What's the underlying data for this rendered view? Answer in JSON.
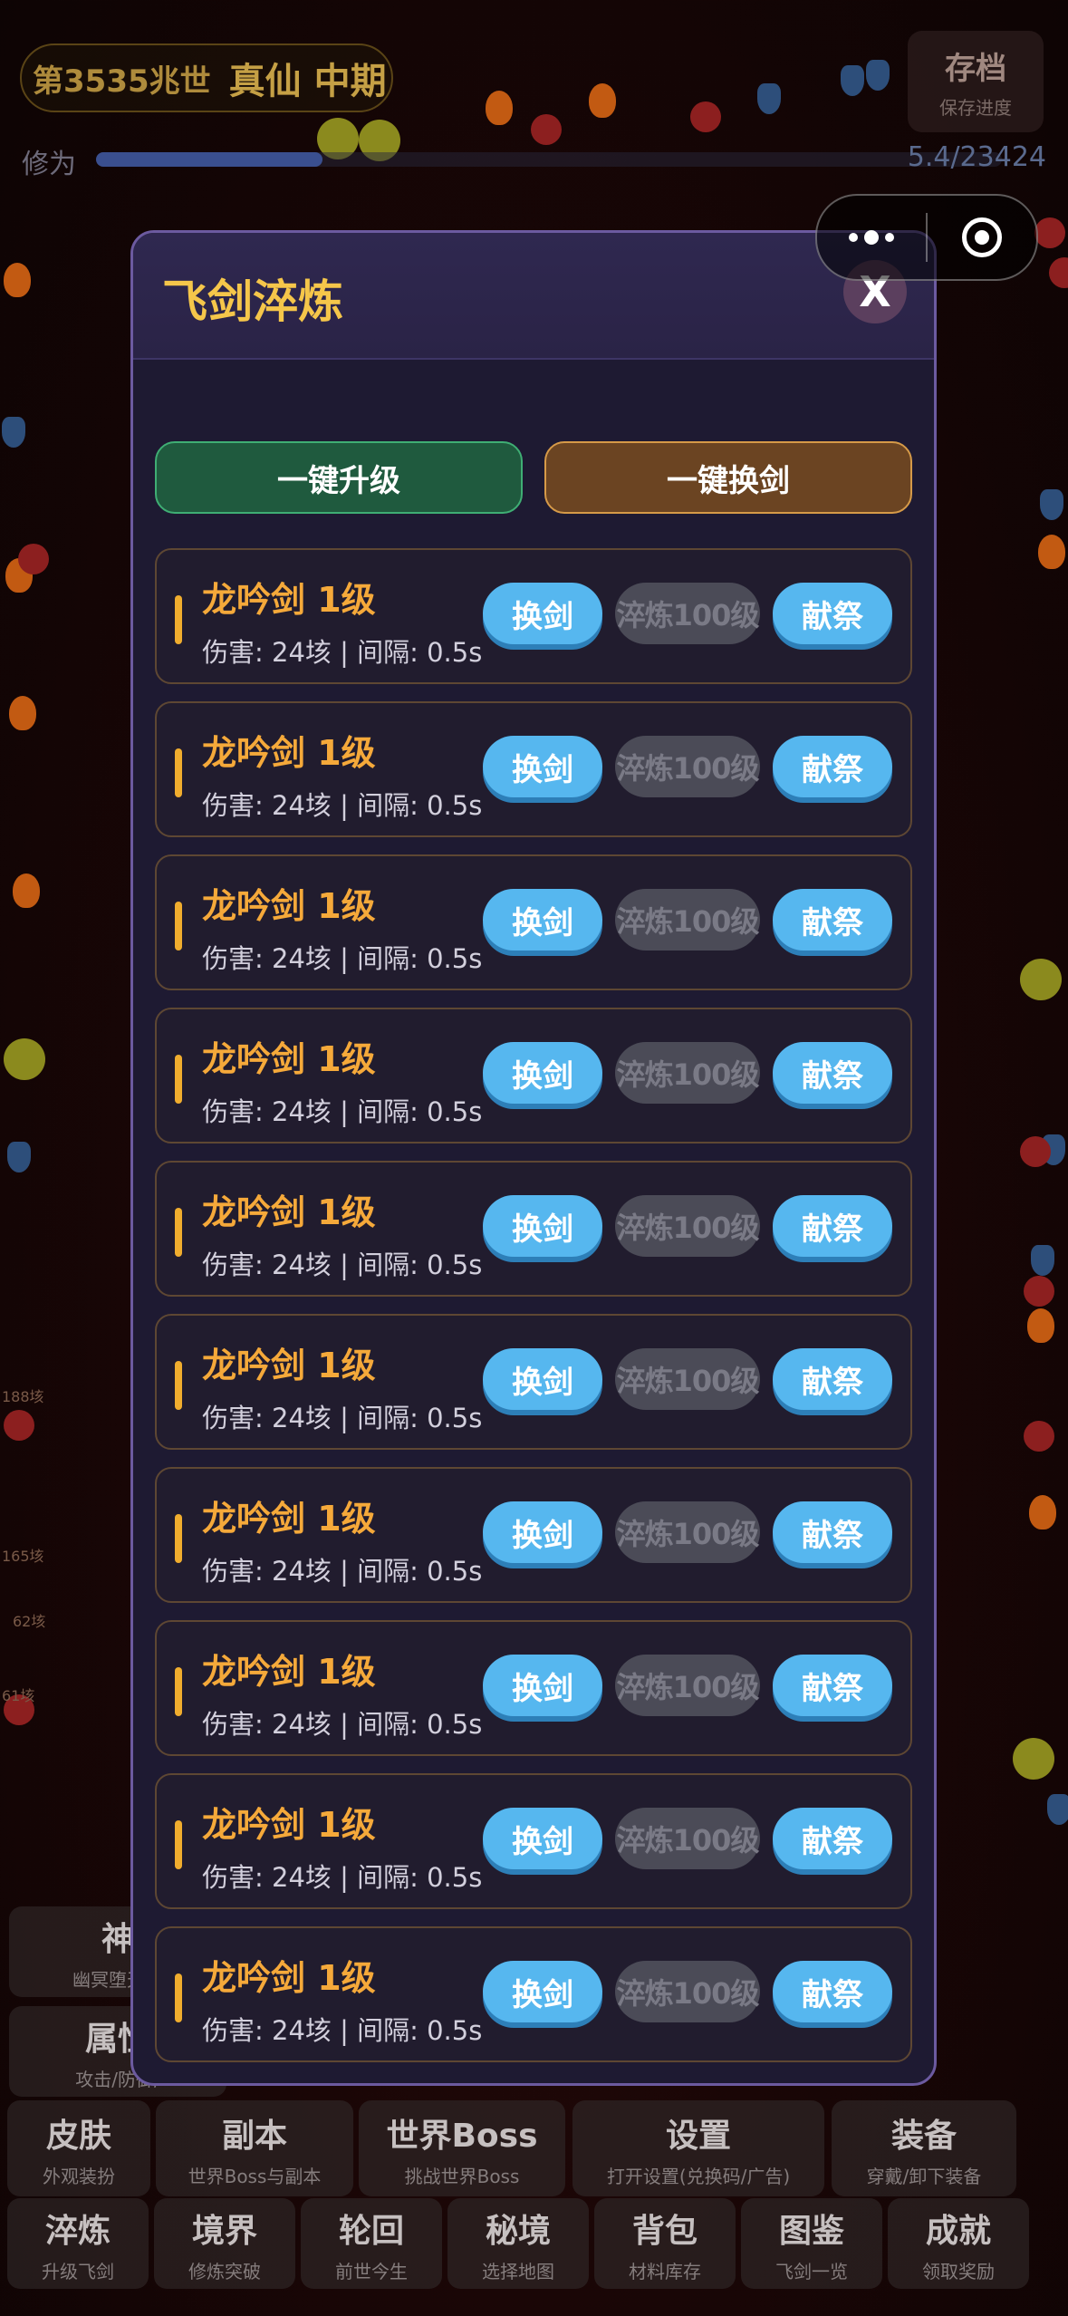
{
  "hud": {
    "era": "第3535兆世",
    "realm": "真仙 中期",
    "save_title": "存档",
    "save_sub": "保存进度",
    "xiuwei_label": "修为",
    "xiuwei_progress": 0.25,
    "xiuwei_value": "5.4/23424"
  },
  "capsule": {
    "more_icon": "more-dots-icon",
    "close_icon": "target-icon"
  },
  "background_labels": [
    "188垓",
    "165垓",
    "62垓",
    "61垓"
  ],
  "modal": {
    "title": "飞剑淬炼",
    "close_label": "X",
    "upgrade_all_label": "一键升级",
    "swap_all_label": "一键换剑",
    "swords": [
      {
        "name": "龙吟剑 1级",
        "stats": "伤害: 24垓 | 间隔: 0.5s",
        "swap": "换剑",
        "temper": "淬炼100级",
        "sacrifice": "献祭"
      },
      {
        "name": "龙吟剑 1级",
        "stats": "伤害: 24垓 | 间隔: 0.5s",
        "swap": "换剑",
        "temper": "淬炼100级",
        "sacrifice": "献祭"
      },
      {
        "name": "龙吟剑 1级",
        "stats": "伤害: 24垓 | 间隔: 0.5s",
        "swap": "换剑",
        "temper": "淬炼100级",
        "sacrifice": "献祭"
      },
      {
        "name": "龙吟剑 1级",
        "stats": "伤害: 24垓 | 间隔: 0.5s",
        "swap": "换剑",
        "temper": "淬炼100级",
        "sacrifice": "献祭"
      },
      {
        "name": "龙吟剑 1级",
        "stats": "伤害: 24垓 | 间隔: 0.5s",
        "swap": "换剑",
        "temper": "淬炼100级",
        "sacrifice": "献祭"
      },
      {
        "name": "龙吟剑 1级",
        "stats": "伤害: 24垓 | 间隔: 0.5s",
        "swap": "换剑",
        "temper": "淬炼100级",
        "sacrifice": "献祭"
      },
      {
        "name": "龙吟剑 1级",
        "stats": "伤害: 24垓 | 间隔: 0.5s",
        "swap": "换剑",
        "temper": "淬炼100级",
        "sacrifice": "献祭"
      },
      {
        "name": "龙吟剑 1级",
        "stats": "伤害: 24垓 | 间隔: 0.5s",
        "swap": "换剑",
        "temper": "淬炼100级",
        "sacrifice": "献祭"
      },
      {
        "name": "龙吟剑 1级",
        "stats": "伤害: 24垓 | 间隔: 0.5s",
        "swap": "换剑",
        "temper": "淬炼100级",
        "sacrifice": "献祭"
      },
      {
        "name": "龙吟剑 1级",
        "stats": "伤害: 24垓 | 间隔: 0.5s",
        "swap": "换剑",
        "temper": "淬炼100级",
        "sacrifice": "献祭"
      }
    ]
  },
  "menu": {
    "row0": [
      {
        "title": "神",
        "sub": "幽冥堕天帝"
      },
      {
        "title": "属性",
        "sub": "攻击/防御/"
      }
    ],
    "row1": [
      {
        "title": "皮肤",
        "sub": "外观装扮"
      },
      {
        "title": "副本",
        "sub": "世界Boss与副本"
      },
      {
        "title": "世界Boss",
        "sub": "挑战世界Boss"
      },
      {
        "title": "设置",
        "sub": "打开设置(兑换码/广告)"
      },
      {
        "title": "装备",
        "sub": "穿戴/卸下装备"
      }
    ],
    "row2": [
      {
        "title": "淬炼",
        "sub": "升级飞剑"
      },
      {
        "title": "境界",
        "sub": "修炼突破"
      },
      {
        "title": "轮回",
        "sub": "前世今生"
      },
      {
        "title": "秘境",
        "sub": "选择地图"
      },
      {
        "title": "背包",
        "sub": "材料库存"
      },
      {
        "title": "图鉴",
        "sub": "飞剑一览"
      },
      {
        "title": "成就",
        "sub": "领取奖励"
      }
    ]
  }
}
